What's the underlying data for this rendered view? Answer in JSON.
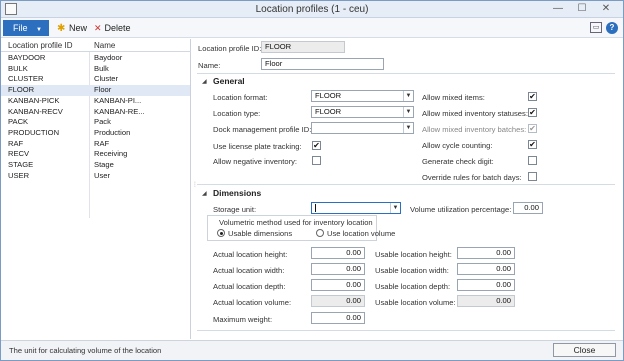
{
  "window": {
    "title": "Location profiles (1 - ceu)",
    "minimize": "—",
    "maximize": "☐",
    "close": "✕"
  },
  "toolbar": {
    "file_label": "File",
    "new_label": "New",
    "delete_label": "Delete",
    "collapse_icon": "▭",
    "help_icon": "?"
  },
  "list": {
    "col_id": "Location profile ID",
    "col_name": "Name",
    "rows": [
      {
        "id": "BAYDOOR",
        "name": "Baydoor"
      },
      {
        "id": "BULK",
        "name": "Bulk"
      },
      {
        "id": "CLUSTER",
        "name": "Cluster"
      },
      {
        "id": "FLOOR",
        "name": "Floor"
      },
      {
        "id": "KANBAN-PICK",
        "name": "KANBAN-PI..."
      },
      {
        "id": "KANBAN-RECV",
        "name": "KANBAN-RE..."
      },
      {
        "id": "PACK",
        "name": "Pack"
      },
      {
        "id": "PRODUCTION",
        "name": "Production"
      },
      {
        "id": "RAF",
        "name": "RAF"
      },
      {
        "id": "RECV",
        "name": "Receiving"
      },
      {
        "id": "STAGE",
        "name": "Stage"
      },
      {
        "id": "USER",
        "name": "User"
      }
    ],
    "selected_index": 3
  },
  "header": {
    "id_label": "Location profile ID:",
    "id_value": "FLOOR",
    "name_label": "Name:",
    "name_value": "Floor"
  },
  "general": {
    "title": "General",
    "location_format_label": "Location format:",
    "location_format_value": "FLOOR",
    "location_type_label": "Location type:",
    "location_type_value": "FLOOR",
    "dock_label": "Dock management profile ID:",
    "dock_value": "",
    "license_plate_label": "Use license plate tracking:",
    "license_plate_checked": true,
    "negative_label": "Allow negative inventory:",
    "negative_checked": false,
    "mixed_items_label": "Allow mixed items:",
    "mixed_items_checked": true,
    "mixed_status_label": "Allow mixed  inventory statuses:",
    "mixed_status_checked": true,
    "mixed_batches_label": "Allow mixed inventory batches:",
    "mixed_batches_checked": true,
    "cycle_label": "Allow cycle counting:",
    "cycle_checked": true,
    "check_digit_label": "Generate check digit:",
    "check_digit_checked": false,
    "override_label": "Override rules for batch days:",
    "override_checked": false
  },
  "dimensions": {
    "title": "Dimensions",
    "storage_unit_label": "Storage unit:",
    "storage_unit_value": "",
    "volume_util_label": "Volume utilization percentage:",
    "volume_util_value": "0.00",
    "method_label": "Volumetric method used for inventory location",
    "radio_usable": "Usable dimensions",
    "radio_location": "Use location volume",
    "actual_height_label": "Actual location height:",
    "actual_height": "0.00",
    "actual_width_label": "Actual location width:",
    "actual_width": "0.00",
    "actual_depth_label": "Actual location depth:",
    "actual_depth": "0.00",
    "actual_volume_label": "Actual location volume:",
    "actual_volume": "0.00",
    "max_weight_label": "Maximum weight:",
    "max_weight": "0.00",
    "usable_height_label": "Usable location height:",
    "usable_height": "0.00",
    "usable_width_label": "Usable location width:",
    "usable_width": "0.00",
    "usable_depth_label": "Usable location depth:",
    "usable_depth": "0.00",
    "usable_volume_label": "Usable location volume:",
    "usable_volume": "0.00"
  },
  "status": {
    "text": "The unit for calculating volume of the location",
    "close_label": "Close"
  }
}
